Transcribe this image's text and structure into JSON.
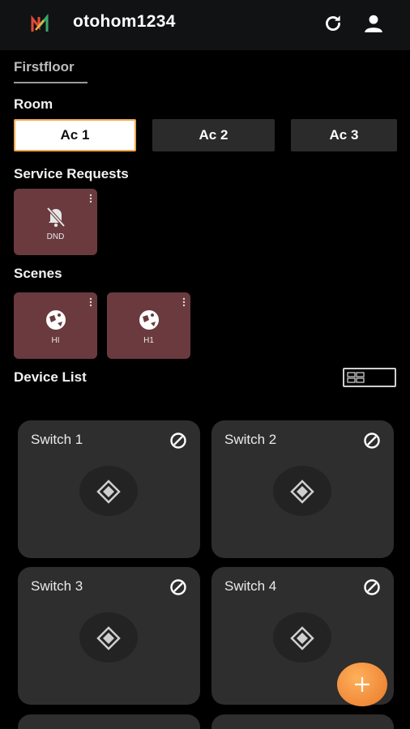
{
  "header": {
    "title": "otohom1234",
    "logo_icon": "app-logo-icon",
    "refresh_icon": "refresh-icon",
    "user_icon": "user-icon"
  },
  "floor_tab": {
    "label": "Firstfloor"
  },
  "room": {
    "heading": "Room",
    "items": [
      {
        "label": "Ac 1",
        "selected": true
      },
      {
        "label": "Ac 2",
        "selected": false
      },
      {
        "label": "Ac 3",
        "selected": false
      }
    ]
  },
  "service_requests": {
    "heading": "Service Requests",
    "items": [
      {
        "label": "DND",
        "icon": "bell-off-icon"
      }
    ]
  },
  "scenes": {
    "heading": "Scenes",
    "items": [
      {
        "label": "HI",
        "icon": "scene-icon"
      },
      {
        "label": "H1",
        "icon": "scene-icon"
      }
    ]
  },
  "device_list": {
    "heading": "Device List",
    "view_toggle_icon": "grid-view-icon",
    "devices": [
      {
        "name": "Switch 1"
      },
      {
        "name": "Switch 2"
      },
      {
        "name": "Switch 3"
      },
      {
        "name": "Switch 4"
      }
    ]
  },
  "fab": {
    "icon": "plus-icon"
  },
  "colors": {
    "background": "#000000",
    "topbar": "#111214",
    "tile": "#6a3a3e",
    "card": "#2e2e2e",
    "accent": "#f0a64f",
    "fab": "#ee8a3a"
  }
}
